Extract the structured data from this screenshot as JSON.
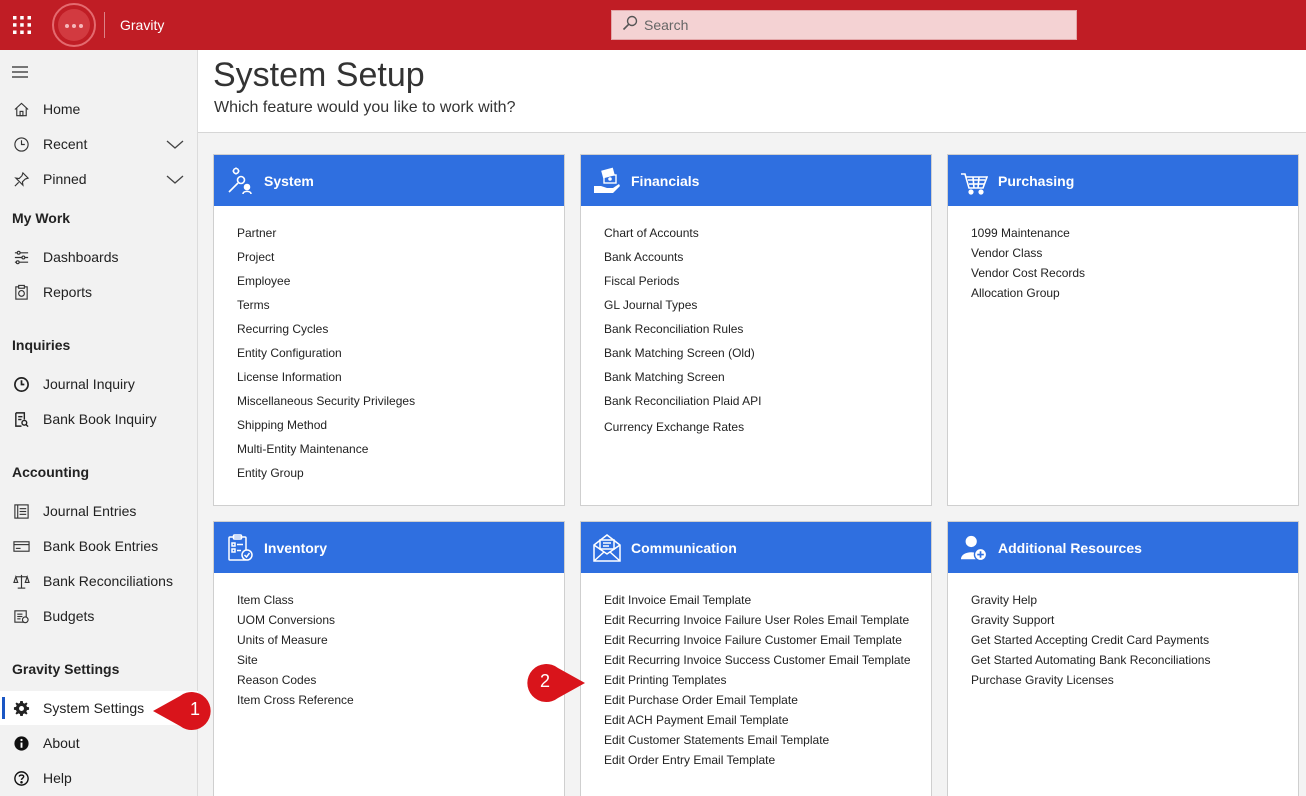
{
  "topbar": {
    "app_name": "Gravity",
    "search_placeholder": "Search"
  },
  "sidebar": {
    "items_top": [
      {
        "label": "Home"
      },
      {
        "label": "Recent"
      },
      {
        "label": "Pinned"
      }
    ],
    "sections": {
      "my_work": "My Work",
      "inquiries": "Inquiries",
      "accounting": "Accounting",
      "gravity_settings": "Gravity Settings"
    },
    "my_work_items": [
      {
        "label": "Dashboards"
      },
      {
        "label": "Reports"
      }
    ],
    "inquiries_items": [
      {
        "label": "Journal Inquiry"
      },
      {
        "label": "Bank Book Inquiry"
      }
    ],
    "accounting_items": [
      {
        "label": "Journal Entries"
      },
      {
        "label": "Bank Book Entries"
      },
      {
        "label": "Bank Reconciliations"
      },
      {
        "label": "Budgets"
      }
    ],
    "settings_items": [
      {
        "label": "System Settings"
      },
      {
        "label": "About"
      },
      {
        "label": "Help"
      }
    ]
  },
  "page": {
    "title": "System Setup",
    "subtitle": "Which feature would you like to work with?"
  },
  "cards": {
    "system": {
      "title": "System",
      "items": [
        "Partner",
        "Project",
        "Employee",
        "Terms",
        "Recurring Cycles",
        "Entity Configuration",
        "License Information",
        "Miscellaneous Security Privileges",
        "Shipping Method",
        "Multi-Entity Maintenance",
        "Entity Group"
      ]
    },
    "financials": {
      "title": "Financials",
      "items": [
        "Chart of Accounts",
        "Bank Accounts",
        "Fiscal Periods",
        "GL Journal Types",
        "Bank Reconciliation Rules",
        "Bank Matching Screen (Old)",
        "Bank Matching Screen",
        "Bank Reconciliation Plaid API",
        "Currency Exchange Rates"
      ]
    },
    "purchasing": {
      "title": "Purchasing",
      "items": [
        "1099 Maintenance",
        "Vendor Class",
        "Vendor Cost Records",
        "Allocation Group"
      ]
    },
    "inventory": {
      "title": "Inventory",
      "items": [
        "Item Class",
        "UOM Conversions",
        "Units of Measure",
        "Site",
        "Reason Codes",
        "Item Cross Reference"
      ]
    },
    "communication": {
      "title": "Communication",
      "items": [
        "Edit Invoice Email Template",
        "Edit Recurring Invoice Failure User Roles Email Template",
        "Edit Recurring Invoice Failure Customer Email Template",
        "Edit Recurring Invoice Success Customer Email Template",
        "Edit Printing Templates",
        "Edit Purchase Order Email Template",
        "Edit ACH Payment Email Template",
        "Edit Customer Statements Email Template",
        "Edit Order Entry Email Template"
      ]
    },
    "resources": {
      "title": "Additional Resources",
      "items": [
        "Gravity Help",
        "Gravity Support",
        "Get Started Accepting Credit Card Payments",
        "Get Started Automating Bank Reconciliations",
        "Purchase Gravity Licenses"
      ]
    }
  },
  "callouts": {
    "one": "1",
    "two": "2"
  },
  "colors": {
    "topbar": "#c01d25",
    "card_header": "#2f6fe0",
    "sidebar": "#f2f2f2",
    "callout": "#d9141b"
  }
}
